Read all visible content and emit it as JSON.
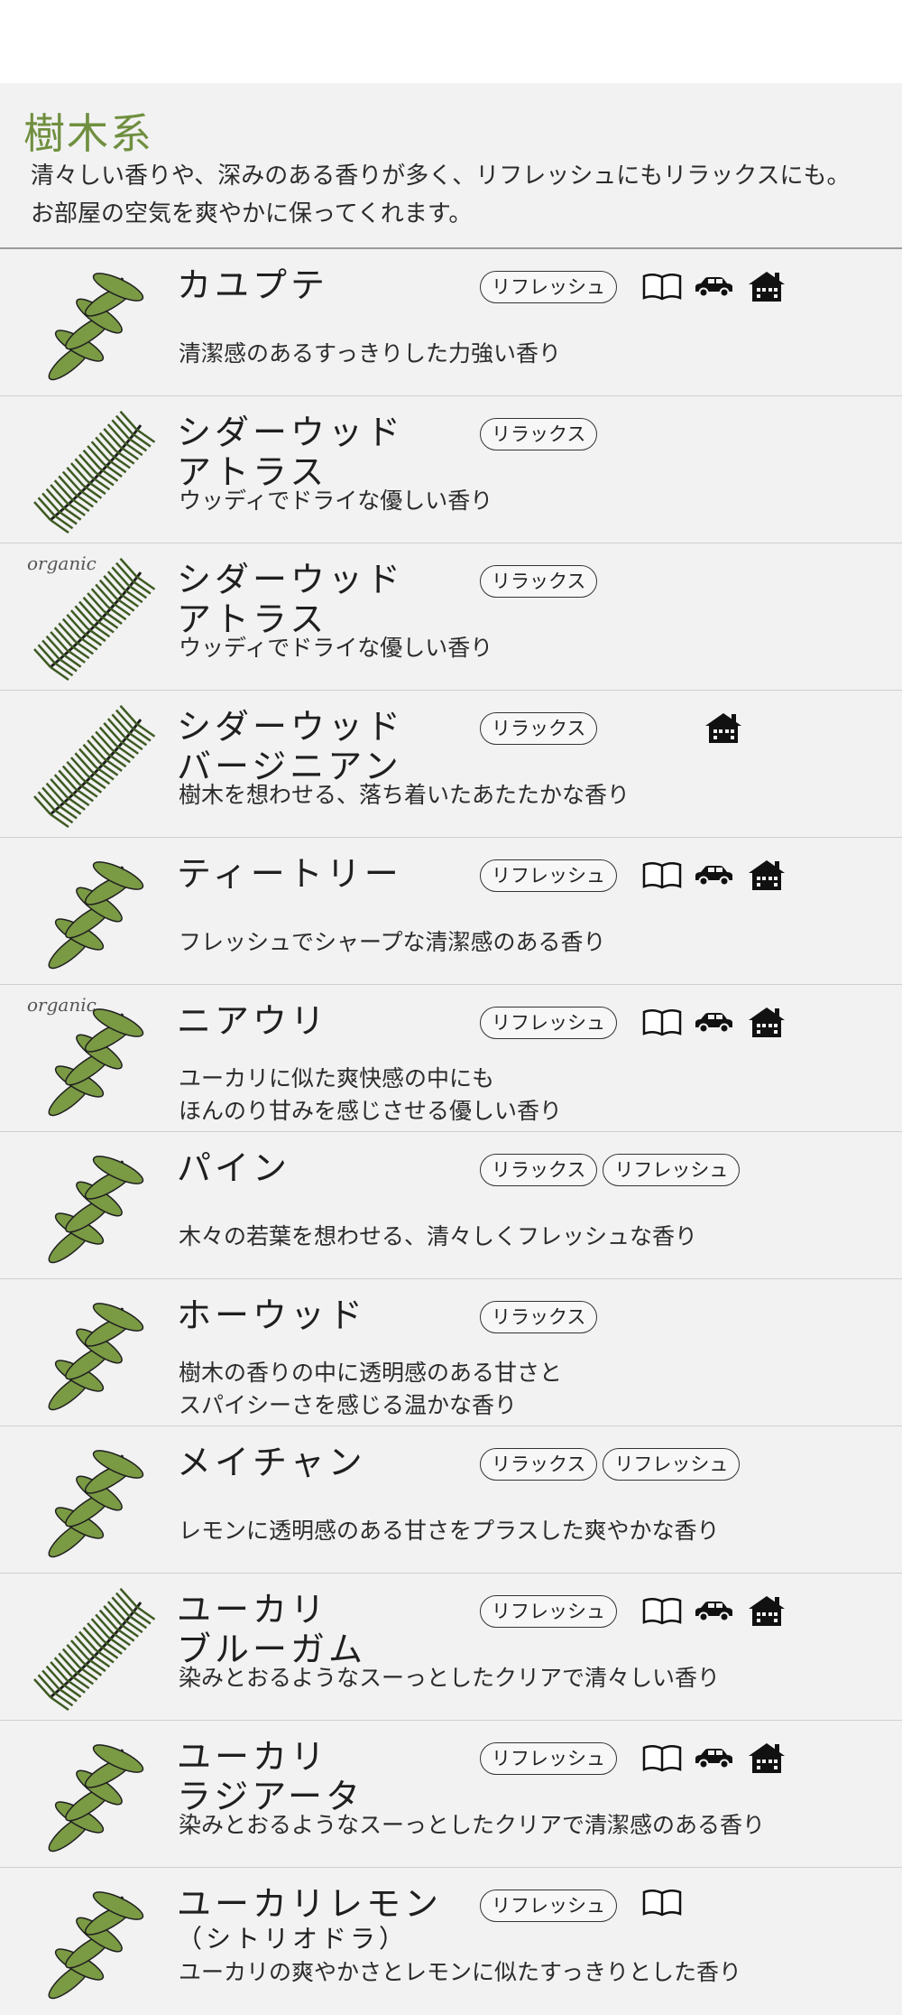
{
  "category": {
    "title": "樹木系",
    "intro_line1": "清々しい香りや、深みのある香りが多く、リフレッシュにもリラックスにも。",
    "intro_line2": "お部屋の空気を爽やかに保ってくれます。"
  },
  "colors": {
    "accent": "#6f8f3f",
    "panel": "#f2f2f2",
    "leaf": "#7a9a44",
    "ink": "#1f1f1f"
  },
  "items": [
    {
      "name1": "カユプテ",
      "name2": "",
      "organic": "",
      "tags": [
        "リフレッシュ"
      ],
      "icons": [
        "book-icon",
        "car-icon",
        "house-icon"
      ],
      "desc1": "清潔感のあるすっきりした力強い香り",
      "desc2": ""
    },
    {
      "name1": "シダーウッド",
      "name2": "アトラス",
      "organic": "",
      "tags": [
        "リラックス"
      ],
      "icons": [
        "moon-icon"
      ],
      "desc1": "ウッディでドライな優しい香り",
      "desc2": ""
    },
    {
      "name1": "シダーウッド",
      "name2": "アトラス",
      "organic": "organic",
      "tags": [
        "リラックス"
      ],
      "icons": [
        "moon-icon"
      ],
      "desc1": "ウッディでドライな優しい香り",
      "desc2": ""
    },
    {
      "name1": "シダーウッド",
      "name2": "バージニアン",
      "organic": "",
      "tags": [
        "リラックス"
      ],
      "icons": [
        "moon-icon",
        "house-icon"
      ],
      "desc1": "樹木を想わせる、落ち着いたあたたかな香り",
      "desc2": ""
    },
    {
      "name1": "ティートリー",
      "name2": "",
      "organic": "",
      "tags": [
        "リフレッシュ"
      ],
      "icons": [
        "book-icon",
        "car-icon",
        "house-icon"
      ],
      "desc1": "フレッシュでシャープな清潔感のある香り",
      "desc2": ""
    },
    {
      "name1": "ニアウリ",
      "name2": "",
      "organic": "organic",
      "tags": [
        "リフレッシュ"
      ],
      "icons": [
        "book-icon",
        "car-icon",
        "house-icon"
      ],
      "desc1": "ユーカリに似た爽快感の中にも",
      "desc2": "ほんのり甘みを感じさせる優しい香り"
    },
    {
      "name1": "パイン",
      "name2": "",
      "organic": "",
      "tags": [
        "リラックス",
        "リフレッシュ"
      ],
      "icons": [],
      "desc1": "木々の若葉を想わせる、清々しくフレッシュな香り",
      "desc2": ""
    },
    {
      "name1": "ホーウッド",
      "name2": "",
      "organic": "",
      "tags": [
        "リラックス"
      ],
      "icons": [
        "moon-icon"
      ],
      "desc1": "樹木の香りの中に透明感のある甘さと",
      "desc2": "スパイシーさを感じる温かな香り"
    },
    {
      "name1": "メイチャン",
      "name2": "",
      "organic": "",
      "tags": [
        "リラックス",
        "リフレッシュ"
      ],
      "icons": [],
      "desc1": "レモンに透明感のある甘さをプラスした爽やかな香り",
      "desc2": ""
    },
    {
      "name1": "ユーカリ",
      "name2": "ブルーガム",
      "organic": "",
      "tags": [
        "リフレッシュ"
      ],
      "icons": [
        "book-icon",
        "car-icon",
        "house-icon"
      ],
      "desc1": "染みとおるようなスーっとしたクリアで清々しい香り",
      "desc2": ""
    },
    {
      "name1": "ユーカリ",
      "name2": "ラジアータ",
      "organic": "",
      "tags": [
        "リフレッシュ"
      ],
      "icons": [
        "book-icon",
        "car-icon",
        "house-icon"
      ],
      "desc1": "染みとおるようなスーっとしたクリアで清潔感のある香り",
      "desc2": ""
    },
    {
      "name1": "ユーカリレモン",
      "name2": "（シトリオドラ）",
      "organic": "",
      "tags": [
        "リフレッシュ"
      ],
      "icons": [
        "book-icon"
      ],
      "desc1": "ユーカリの爽やかさとレモンに似たすっきりとした香り",
      "desc2": ""
    }
  ]
}
